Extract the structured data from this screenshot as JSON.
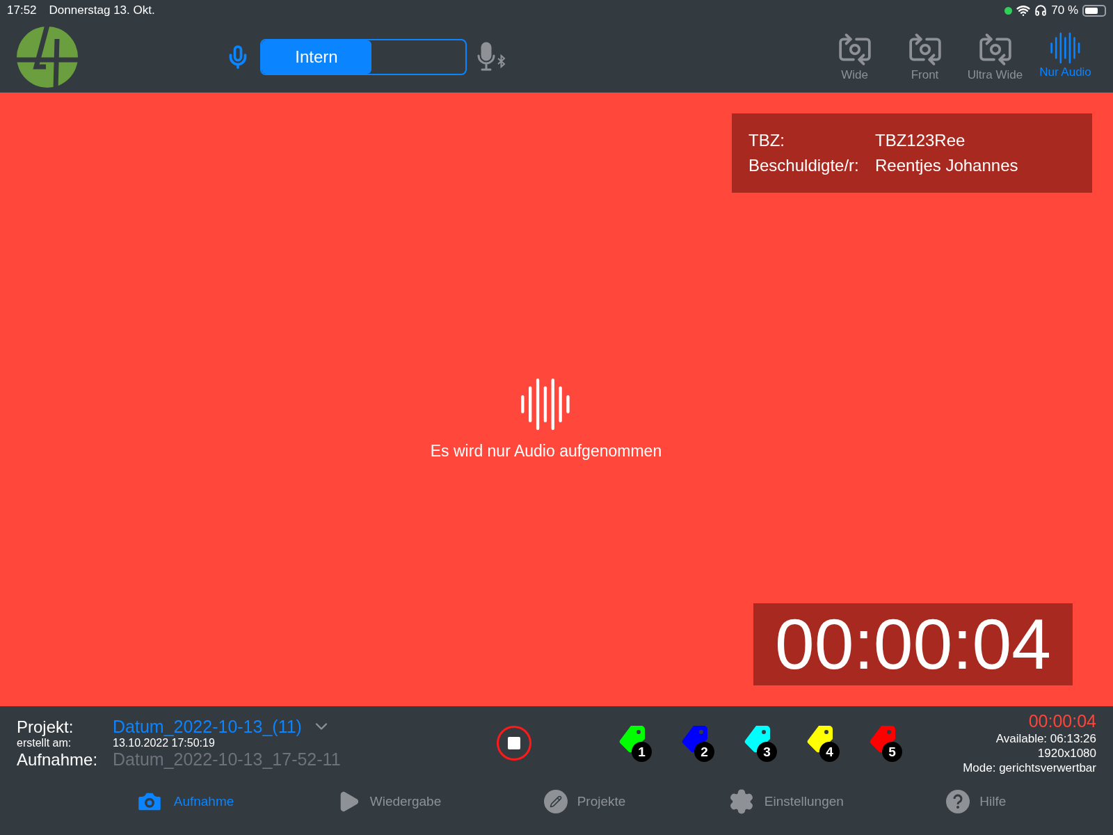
{
  "status_bar": {
    "time": "17:52",
    "date": "Donnerstag 13. Okt.",
    "battery": "70 %"
  },
  "source": {
    "label": "Intern",
    "internal": true
  },
  "cameras": [
    {
      "label": "Wide",
      "kind": "camera",
      "selected": false
    },
    {
      "label": "Front",
      "kind": "camera",
      "selected": false
    },
    {
      "label": "Ultra Wide",
      "kind": "camera",
      "selected": false
    },
    {
      "label": "Nur Audio",
      "kind": "audio",
      "selected": true
    }
  ],
  "info_panel": [
    {
      "label": "TBZ:",
      "value": "TBZ123Ree"
    },
    {
      "label": "Beschuldigte/r:",
      "value": "Reentjes Johannes"
    }
  ],
  "message": "Es wird nur Audio aufgenommen",
  "timer": "00:00:04",
  "project": {
    "label": "Projekt:",
    "name": "Datum_2022-10-13_(11)",
    "created_label": "erstellt am:",
    "created": "13.10.2022 17:50:19",
    "recording_label": "Aufnahme:",
    "recording": "Datum_2022-10-13_17-52-11"
  },
  "record_button": {
    "recording": true
  },
  "tags": [
    {
      "number": "1",
      "color": "#00ff00"
    },
    {
      "number": "2",
      "color": "#0000ff"
    },
    {
      "number": "3",
      "color": "#00ffff"
    },
    {
      "number": "4",
      "color": "#ffff00"
    },
    {
      "number": "5",
      "color": "#ff0000"
    }
  ],
  "stats": {
    "elapsed": "00:00:04",
    "available": "Available: 06:13:26",
    "resolution": "1920x1080",
    "mode": "Mode: gerichtsverwertbar"
  },
  "tabs": [
    {
      "label": "Aufnahme",
      "kind": "camera",
      "selected": true
    },
    {
      "label": "Wiedergabe",
      "kind": "play",
      "selected": false
    },
    {
      "label": "Projekte",
      "kind": "pencil",
      "selected": false
    },
    {
      "label": "Einstellungen",
      "kind": "gear",
      "selected": false
    },
    {
      "label": "Hilfe",
      "kind": "help",
      "selected": false
    }
  ]
}
